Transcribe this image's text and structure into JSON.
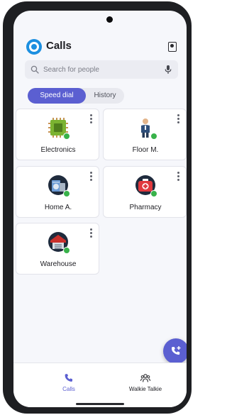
{
  "header": {
    "title": "Calls",
    "logo_icon": "calls-app-logo",
    "action_icon": "contact-card-icon"
  },
  "search": {
    "placeholder": "Search for people",
    "icon": "search-icon",
    "voice_icon": "mic-icon"
  },
  "tabs": [
    {
      "label": "Speed dial",
      "active": true
    },
    {
      "label": "History",
      "active": false
    }
  ],
  "speed_dial": [
    {
      "label": "Electronics",
      "icon": "circuit-chip-icon",
      "status": "available"
    },
    {
      "label": "Floor M.",
      "icon": "person-icon",
      "status": "available"
    },
    {
      "label": "Home A.",
      "icon": "appliances-icon",
      "status": "available"
    },
    {
      "label": "Pharmacy",
      "icon": "first-aid-kit-icon",
      "status": "available"
    },
    {
      "label": "Warehouse",
      "icon": "warehouse-icon",
      "status": "available"
    }
  ],
  "fab": {
    "icon": "add-call-icon"
  },
  "bottom_nav": [
    {
      "label": "Calls",
      "icon": "phone-icon",
      "active": true
    },
    {
      "label": "Walkie Talkie",
      "icon": "walkie-talkie-icon",
      "active": false
    }
  ],
  "colors": {
    "accent": "#5b5fd1",
    "logo": "#1c8fe0",
    "presence_available": "#38b24a",
    "phone_frame": "#1e1f22"
  }
}
